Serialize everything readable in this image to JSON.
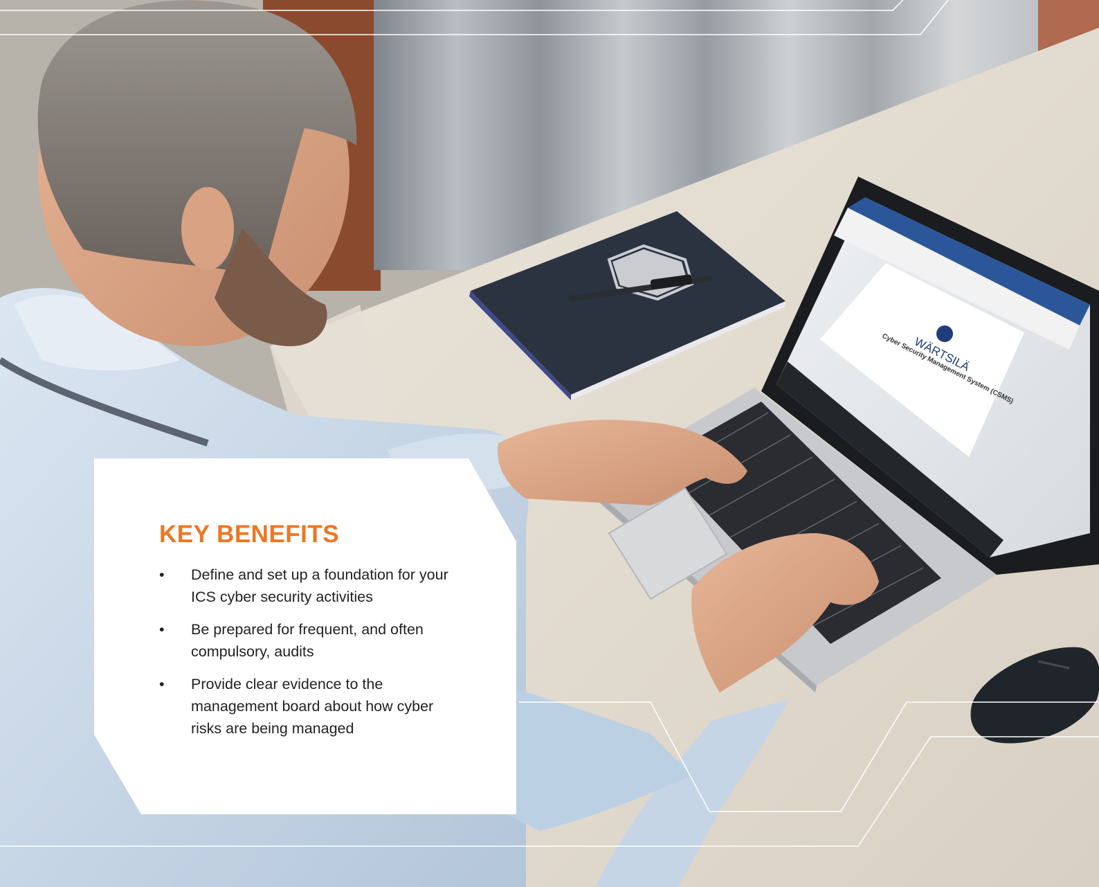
{
  "colors": {
    "accent": "#ee7623",
    "text": "#222222",
    "card": "#ffffff",
    "deco_line": "#ffffff"
  },
  "photo": {
    "laptop_screen_logo": "WÄRTSILÄ",
    "laptop_screen_text": "Cyber Security Management System (CSMS)"
  },
  "benefits": {
    "title": "KEY BENEFITS",
    "items": [
      {
        "bullet": "•",
        "text": "Define and set up a foundation for your ICS cyber security activities"
      },
      {
        "bullet": "•",
        "text": "Be prepared for frequent, and often compulsory, audits"
      },
      {
        "bullet": "•",
        "text": "Provide clear evidence to the management board about how cyber risks are being managed"
      }
    ]
  }
}
